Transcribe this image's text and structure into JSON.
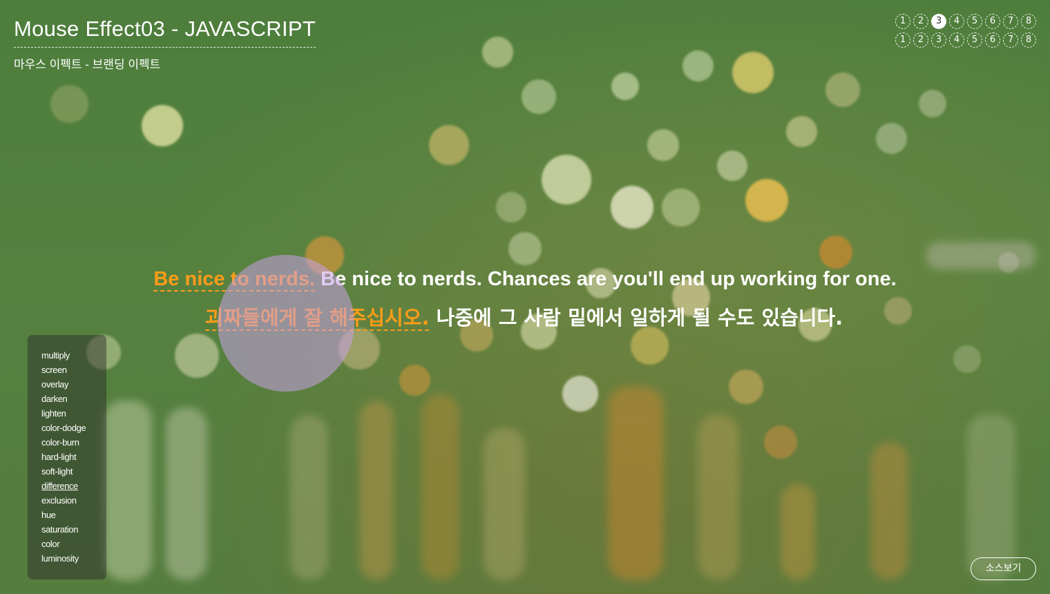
{
  "header": {
    "title": "Mouse Effect03 - JAVASCRIPT",
    "subtitle": "마우스 이펙트 - 브랜딩 이펙트"
  },
  "pager": {
    "row1": [
      "1",
      "2",
      "3",
      "4",
      "5",
      "6",
      "7",
      "8"
    ],
    "row2": [
      "1",
      "2",
      "3",
      "4",
      "5",
      "6",
      "7",
      "8"
    ],
    "active_row1": "3"
  },
  "quote": {
    "en_highlight": "Be nice to nerds.",
    "en_rest": " Be nice to nerds. Chances are you'll end up working for one.",
    "ko_highlight": "괴짜들에게 잘 해주십시오.",
    "ko_rest": " 나중에 그 사람 밑에서 일하게 될 수도 있습니다."
  },
  "blend_modes": {
    "items": [
      "multiply",
      "screen",
      "overlay",
      "darken",
      "lighten",
      "color-dodge",
      "color-burn",
      "hard-light",
      "soft-light",
      "difference",
      "exclusion",
      "hue",
      "saturation",
      "color",
      "luminosity"
    ],
    "selected": "difference"
  },
  "source_button": {
    "label": "소스보기"
  },
  "colors": {
    "highlight": "#ff9c18",
    "cursor": "#c9a2e7",
    "background": "#4f7f3f"
  }
}
